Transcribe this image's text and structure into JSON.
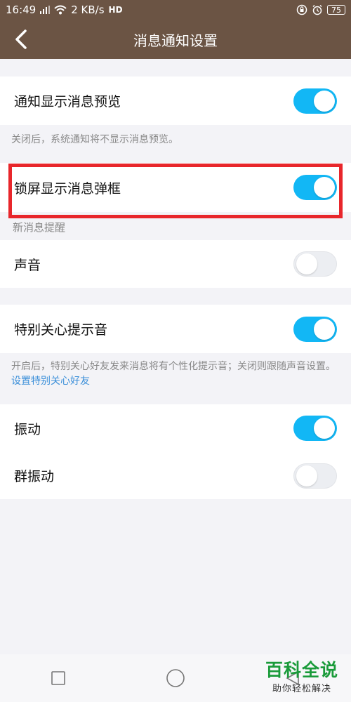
{
  "status_bar": {
    "time": "16:49",
    "speed": "2 KB/s",
    "hd": "HD",
    "battery": "75"
  },
  "header": {
    "title": "消息通知设置"
  },
  "settings": {
    "preview": {
      "label": "通知显示消息预览",
      "on": true
    },
    "preview_note": "关闭后，系统通知将不显示消息预览。",
    "lockscreen": {
      "label": "锁屏显示消息弹框",
      "on": true
    },
    "new_msg_section": "新消息提醒",
    "sound": {
      "label": "声音",
      "on": false
    },
    "special_tone": {
      "label": "特别关心提示音",
      "on": true
    },
    "special_note": "开启后，特别关心好友发来消息将有个性化提示音；关闭则跟随声音设置。",
    "special_link": "设置特别关心好友",
    "vibrate": {
      "label": "振动",
      "on": true
    },
    "group_vibrate": {
      "label": "群振动",
      "on": false
    }
  },
  "watermark": {
    "title": "百科全说",
    "subtitle": "助你轻松解决"
  },
  "colors": {
    "header_bg": "#6b5444",
    "toggle_on": "#12b7f5",
    "highlight": "#e8262b"
  }
}
